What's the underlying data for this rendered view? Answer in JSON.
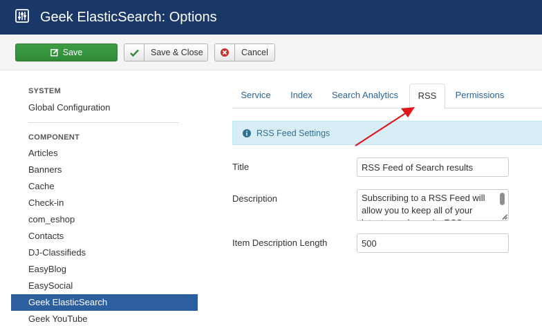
{
  "header": {
    "title": "Geek ElasticSearch: Options",
    "icon": "options-sliders-icon"
  },
  "toolbar": {
    "save_label": "Save",
    "save_close_label": "Save & Close",
    "cancel_label": "Cancel"
  },
  "sidebar": {
    "system_heading": "SYSTEM",
    "system_items": [
      {
        "label": "Global Configuration"
      }
    ],
    "component_heading": "COMPONENT",
    "component_items": [
      {
        "label": "Articles"
      },
      {
        "label": "Banners"
      },
      {
        "label": "Cache"
      },
      {
        "label": "Check-in"
      },
      {
        "label": "com_eshop"
      },
      {
        "label": "Contacts"
      },
      {
        "label": "DJ-Classifieds"
      },
      {
        "label": "EasyBlog"
      },
      {
        "label": "EasySocial"
      },
      {
        "label": "Geek ElasticSearch",
        "active": true
      },
      {
        "label": "Geek YouTube"
      }
    ]
  },
  "tabs": [
    {
      "label": "Service"
    },
    {
      "label": "Index"
    },
    {
      "label": "Search Analytics"
    },
    {
      "label": "RSS",
      "active": true
    },
    {
      "label": "Permissions"
    }
  ],
  "info": {
    "text": "RSS Feed Settings"
  },
  "form": {
    "title_label": "Title",
    "title_value": "RSS Feed of Search results",
    "description_label": "Description",
    "description_value": "Subscribing to a RSS Feed will allow you to keep all of your latest search results RSS",
    "length_label": "Item Description Length",
    "length_value": "500"
  },
  "colors": {
    "header_bg": "#1a3867",
    "save_green": "#2f8a38",
    "active_sidebar": "#2d5f9e",
    "link_blue": "#2a6496",
    "info_bg": "#d9edf7",
    "annotation_arrow": "#e0151b"
  }
}
